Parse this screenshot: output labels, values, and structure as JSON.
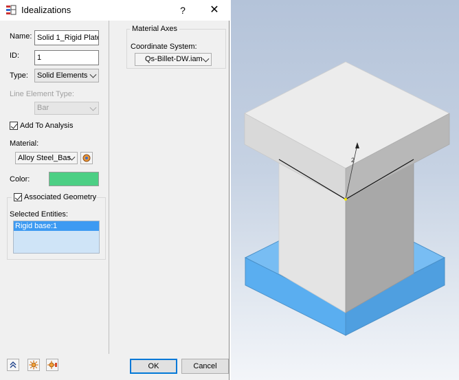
{
  "window": {
    "title": "Idealizations",
    "help_label": "?",
    "close_label": "✕"
  },
  "left": {
    "name_label": "Name:",
    "name_value": "Solid 1_Rigid Plate",
    "id_label": "ID:",
    "id_value": "1",
    "type_label": "Type:",
    "type_value": "Solid Elements",
    "line_element_label": "Line Element Type:",
    "line_element_value": "Bar",
    "add_to_analysis_label": "Add To Analysis",
    "material_label": "Material:",
    "material_value": "Alloy Steel_Bas",
    "color_label": "Color:",
    "color_swatch": "#4ccf84",
    "associated_label": "Associated Geometry",
    "selected_entities_label": "Selected Entities:",
    "selected_entities": [
      "Rigid base:1"
    ]
  },
  "right": {
    "group_title": "Material Axes",
    "coord_label": "Coordinate System:",
    "coord_value": "Qs-Billet-DW.iam"
  },
  "footer": {
    "ok_label": "OK",
    "cancel_label": "Cancel"
  },
  "viewport": {
    "axis_label": "2",
    "base_color": "#5aaef0",
    "block_color": "#e2e2e2"
  }
}
